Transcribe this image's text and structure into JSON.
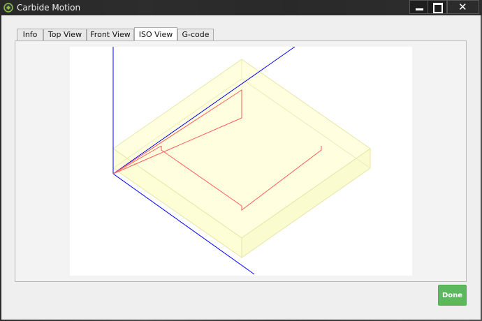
{
  "window": {
    "title": "Carbide Motion"
  },
  "tabs": [
    {
      "label": "Info"
    },
    {
      "label": "Top View"
    },
    {
      "label": "Front View"
    },
    {
      "label": "ISO View"
    },
    {
      "label": "G-code"
    }
  ],
  "active_tab": "ISO View",
  "footer": {
    "done_label": "Done"
  },
  "colors": {
    "stock_fill": "#ffffe0",
    "stock_edge": "#e6e6a8",
    "axis": "#0000ff",
    "toolpath": "#ff4d4d",
    "done_button": "#5cb85c"
  }
}
